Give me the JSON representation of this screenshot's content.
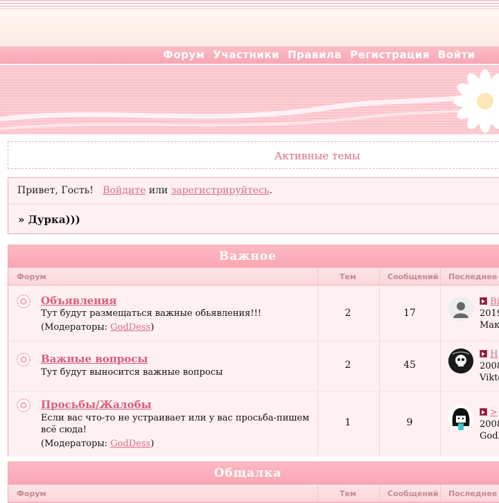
{
  "nav": {
    "items": [
      "Форум",
      "Участники",
      "Правила",
      "Регистрация",
      "Войти"
    ]
  },
  "notice": {
    "active_topics": "Активные темы"
  },
  "greeting": {
    "hello": "Привет, Гость!",
    "login": "Войдите",
    "or": "или",
    "register": "зарегистрируйтесь",
    "period": ".",
    "topic": "» Дурка)))"
  },
  "categories": [
    {
      "title": "Важное",
      "columns": {
        "forum": "Форум",
        "topics": "Тем",
        "posts": "Сообщений",
        "last": "Последнее с"
      },
      "forums": [
        {
          "title": "Объявления",
          "desc": "Тут будут размещаться важные обьявления!!!",
          "mod_label": "(Модераторы: ",
          "moderator": "GodDess",
          "mod_close": ")",
          "topics": "2",
          "posts": "17",
          "last_link": "Вi",
          "last_date": "2019",
          "last_user": "Мак"
        },
        {
          "title": "Важные вопросы",
          "desc": "Тут будут выносится важные вопросы",
          "topics": "2",
          "posts": "45",
          "last_link": "Н",
          "last_date": "2008",
          "last_user": "Vikto"
        },
        {
          "title": "Просьбы/Жалобы",
          "desc": "Если вас что-то не устраивает или у вас просьба-пишем всё сюда!",
          "mod_label": "(Модераторы: ",
          "moderator": "GodDess",
          "mod_close": ")",
          "topics": "1",
          "posts": "9",
          "last_link": ">",
          "last_date": "2008",
          "last_user": "GodI"
        }
      ]
    },
    {
      "title": "Общалка",
      "columns": {
        "forum": "Форум",
        "topics": "Тем",
        "posts": "Сообщений",
        "last": "Последнее с"
      }
    }
  ]
}
